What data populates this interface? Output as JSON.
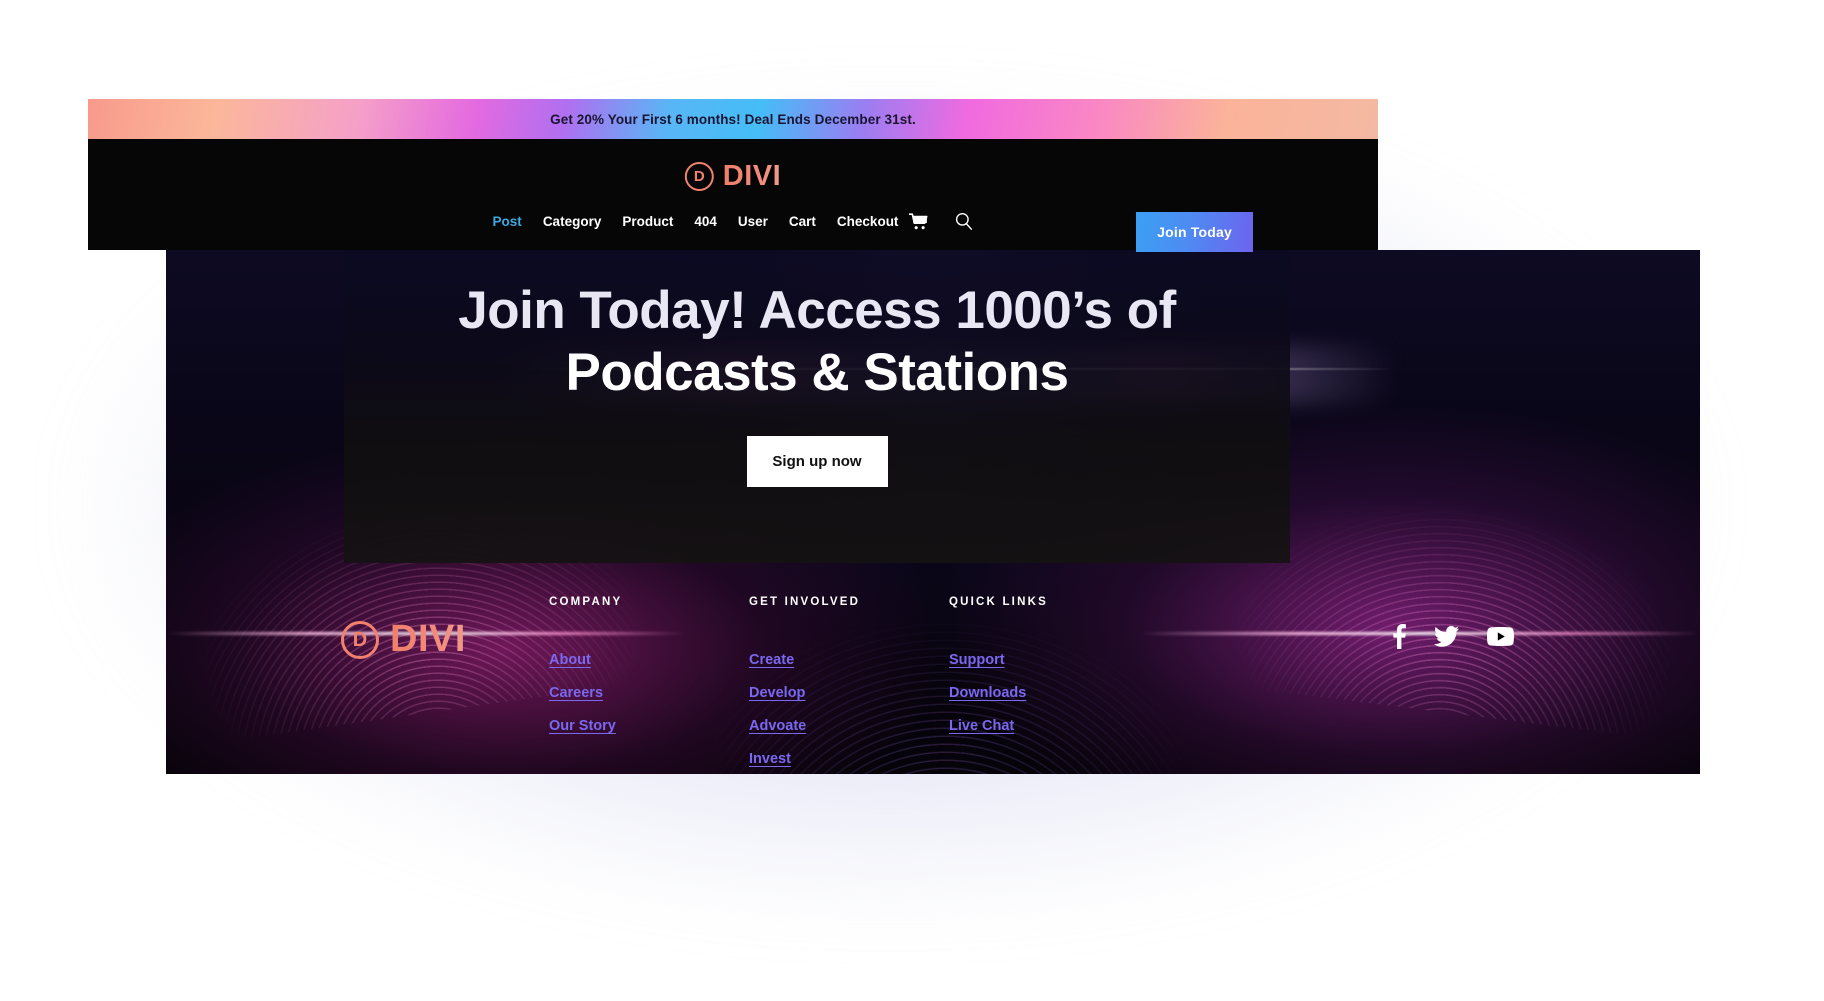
{
  "promo": {
    "text": "Get 20% Your First 6 months! Deal Ends December 31st."
  },
  "header": {
    "logo": {
      "mark": "D",
      "word": "DIVI"
    },
    "nav": [
      {
        "label": "Post",
        "active": true
      },
      {
        "label": "Category",
        "active": false
      },
      {
        "label": "Product",
        "active": false
      },
      {
        "label": "404",
        "active": false
      },
      {
        "label": "User",
        "active": false
      },
      {
        "label": "Cart",
        "active": false
      },
      {
        "label": "Checkout",
        "active": false
      }
    ],
    "cart_icon": "shopping-cart-icon",
    "search_icon": "search-icon",
    "cta": {
      "label": "Join Today"
    }
  },
  "hero": {
    "title_line1": "Join Today! Access 1000’s of",
    "title_line2": "Podcasts & Stations",
    "cta": {
      "label": "Sign up now"
    }
  },
  "footer": {
    "logo": {
      "mark": "D",
      "word": "DIVI"
    },
    "columns": [
      {
        "heading": "COMPANY",
        "links": [
          "About",
          "Careers",
          "Our Story"
        ]
      },
      {
        "heading": "GET INVOLVED",
        "links": [
          "Create",
          "Develop",
          "Advoate",
          "Invest"
        ]
      },
      {
        "heading": "QUICK LINKS",
        "links": [
          "Support",
          "Downloads",
          "Live Chat"
        ]
      }
    ],
    "social": [
      {
        "name": "facebook-icon"
      },
      {
        "name": "twitter-icon"
      },
      {
        "name": "youtube-icon"
      }
    ]
  },
  "colors": {
    "brand_coral": "#f2826e",
    "nav_active_blue": "#3ea8e0",
    "footer_link_purple": "#7b68f0",
    "cta_gradient_start": "#3ba0f4",
    "cta_gradient_end": "#6d63ef",
    "page_background": "#ffffff",
    "panel_black": "#060606"
  }
}
